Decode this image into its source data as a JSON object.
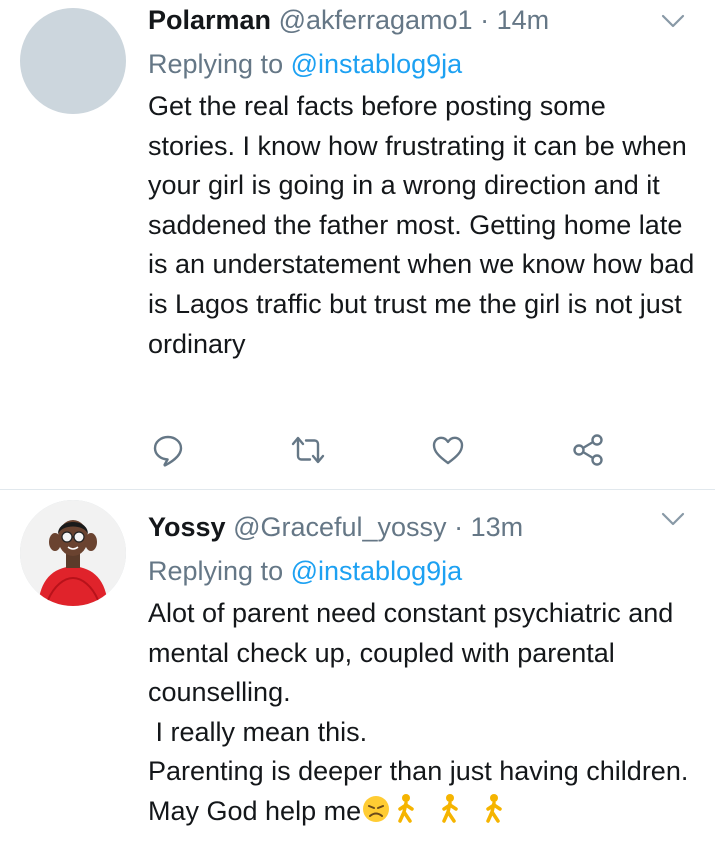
{
  "tweets": [
    {
      "name": "Polarman",
      "handle": "@akferragamo1",
      "separator": "·",
      "time": "14m",
      "reply_prefix": "Replying to",
      "reply_to": "@instablog9ja",
      "text": "Get the real facts before posting some stories. I know how frustrating it can be when your girl is going in a wrong direction and it saddened the father most. Getting home late is an understatement when we know how bad is Lagos traffic but trust me the girl is not just ordinary",
      "actions": [
        "reply-icon",
        "retweet-icon",
        "like-icon",
        "share-icon"
      ]
    },
    {
      "name": "Yossy",
      "handle": "@Graceful_yossy",
      "separator": "·",
      "time": "13m",
      "reply_prefix": "Replying to",
      "reply_to": "@instablog9ja",
      "text_lines": [
        "Alot of parent need constant psychiatric and mental check up, coupled with parental counselling.",
        " I really mean this.",
        "Parenting is deeper than just having children. May God help me"
      ],
      "emojis": [
        "disappointed-face",
        "person-walking",
        "person-walking",
        "person-walking"
      ]
    }
  ],
  "colors": {
    "text": "#14171a",
    "secondary": "#657786",
    "link": "#1da1f2",
    "divider": "#e1e8ed",
    "icon": "#657786"
  }
}
